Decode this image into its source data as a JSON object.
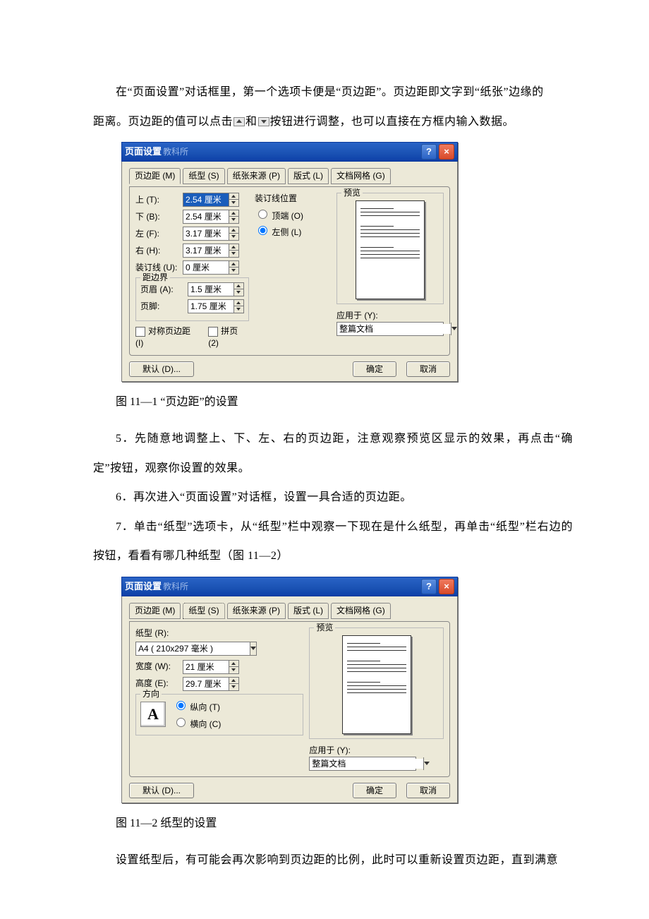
{
  "doc": {
    "p1a": "在“页面设置”对话框里，第一个选项卡便是“页边距”。页边距即文字到“纸张”边缘的",
    "p1b_prefix": "距离。页边距的值可以点击",
    "p1b_mid": "和",
    "p1b_suffix": "按钮进行调整，也可以直接在方框内输入数据。",
    "cap1": "图 11—1   “页边距”的设置",
    "p5": "5．先随意地调整上、下、左、右的页边距，注意观察预览区显示的效果，再点击“确定”按钮，观察你设置的效果。",
    "p6": "6．再次进入“页面设置”对话框，设置一具合适的页边距。",
    "p7": "7．单击“纸型”选项卡，从“纸型”栏中观察一下现在是什么纸型，再单击“纸型”栏右边的按钮，看看有哪几种纸型（图 11—2）",
    "cap2": "图 11—2   纸型的设置",
    "p_after": "设置纸型后，有可能会再次影响到页边距的比例，此时可以重新设置页边距，直到满意"
  },
  "dlg": {
    "title": "页面设置",
    "title_sub": "教科所",
    "tabs": {
      "margins": "页边距 (M)",
      "paper": "纸型 (S)",
      "source": "纸张来源 (P)",
      "layout": "版式 (L)",
      "grid": "文档网格 (G)"
    },
    "labels": {
      "top": "上 (T):",
      "bottom": "下 (B):",
      "left": "左 (F):",
      "right": "右 (H):",
      "gutter": "装订线 (U):",
      "edge_group": "距边界",
      "header": "页眉 (A):",
      "footer": "页脚:",
      "gutter_pos": "装订线位置",
      "gutter_top": "顶端 (O)",
      "gutter_left": "左侧 (L)",
      "preview": "预览",
      "mirror": "对称页边距 (I)",
      "twosheet": "拼页 (2)",
      "apply_to": "应用于 (Y):",
      "default_btn": "默认 (D)...",
      "ok": "确定",
      "cancel": "取消",
      "paper_size": "纸型 (R):",
      "width": "宽度 (W):",
      "height": "高度 (E):",
      "orientation": "方向",
      "portrait": "纵向 (T)",
      "landscape": "横向 (C)"
    },
    "values": {
      "top": "2.54 厘米",
      "bottom": "2.54 厘米",
      "left": "3.17 厘米",
      "right": "3.17 厘米",
      "gutter": "0 厘米",
      "header": "1.5 厘米",
      "footer": "1.75 厘米",
      "apply_to": "整篇文档",
      "paper_size": "A4 ( 210x297 毫米 )",
      "width": "21 厘米",
      "height": "29.7 厘米",
      "orientation_letter": "A"
    }
  }
}
